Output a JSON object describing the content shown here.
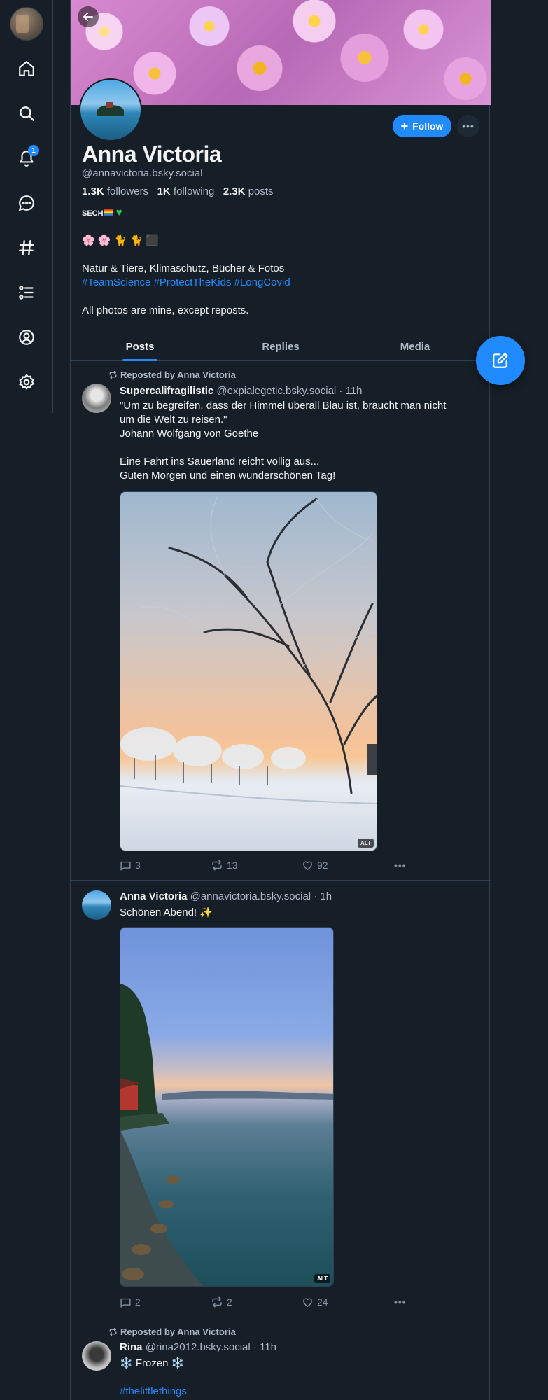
{
  "nav": {
    "items": [
      "home",
      "search",
      "notifications",
      "chat",
      "feeds",
      "lists",
      "profile",
      "settings"
    ],
    "notifications_badge": "1"
  },
  "profile": {
    "display_name": "Anna Victoria",
    "handle": "@annavictoria.bsky.social",
    "followers_count": "1.3K",
    "followers_label": "followers",
    "following_count": "1K",
    "following_label": "following",
    "posts_count": "2.3K",
    "posts_label": "posts",
    "follow_label": "Follow",
    "bio": {
      "line1": "SECH",
      "line2": "🌸 🌸 🐈 🐈 ⬛",
      "line3": "Natur & Tiere, Klimaschutz, Bücher & Fotos",
      "hashtags": [
        "#TeamScience",
        "#ProtectTheKids",
        "#LongCovid"
      ],
      "line5": "All photos are mine, except reposts."
    }
  },
  "tabs": [
    "Posts",
    "Replies",
    "Media"
  ],
  "posts": [
    {
      "repost_label": "Reposted by Anna Victoria",
      "author": "Supercalifragilistic",
      "handle": "@expialegetic.bsky.social",
      "time": "· 11h",
      "text_lines": [
        "\"Um zu begreifen, dass der Himmel überall Blau ist, braucht man nicht",
        "um die Welt zu reisen.\"",
        "Johann Wolfgang von Goethe",
        "",
        "Eine Fahrt ins Sauerland reicht völlig aus...",
        "Guten Morgen und einen wunderschönen Tag!"
      ],
      "alt": "ALT",
      "replies": "3",
      "reposts": "13",
      "likes": "92"
    },
    {
      "author": "Anna Victoria",
      "handle": "@annavictoria.bsky.social",
      "time": "· 1h",
      "text": "Schönen Abend! ✨",
      "alt": "ALT",
      "replies": "2",
      "reposts": "2",
      "likes": "24"
    },
    {
      "repost_label": "Reposted by Anna Victoria",
      "author": "Rina",
      "handle": "@rina2012.bsky.social",
      "time": "· 11h",
      "text": "❄️ Frozen ❄️",
      "hashtag": "#thelittlethings"
    }
  ],
  "colors": {
    "background": "#161e27",
    "border": "#2e4052",
    "accent": "#208bfe",
    "text": "#f1f3f5",
    "muted": "#aebbc9"
  }
}
